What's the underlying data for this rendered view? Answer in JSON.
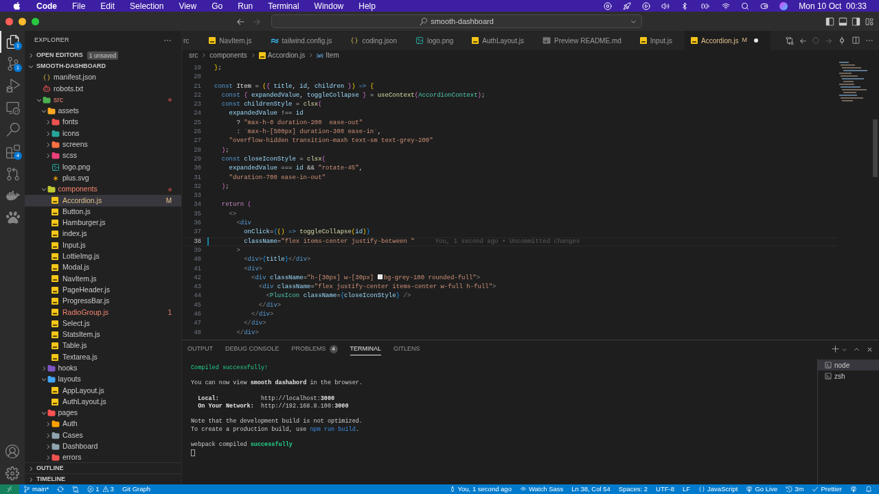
{
  "menubar": {
    "app": "Code",
    "menus": [
      "File",
      "Edit",
      "Selection",
      "View",
      "Go",
      "Run",
      "Terminal",
      "Window",
      "Help"
    ],
    "clock": "Mon 10 Oct  00:33"
  },
  "title_bar": {
    "search": "smooth-dashboard"
  },
  "activity_bar": [
    {
      "kind": "files",
      "selected": true,
      "badge": "1"
    },
    {
      "kind": "source-control",
      "selected": false,
      "badge": "1"
    },
    {
      "kind": "run-debug",
      "selected": false
    },
    {
      "kind": "remote",
      "selected": false
    },
    {
      "kind": "search",
      "selected": false
    },
    {
      "kind": "extensions",
      "selected": false,
      "badge": "4"
    },
    {
      "kind": "git-graph",
      "selected": false
    },
    {
      "kind": "docker",
      "selected": false
    },
    {
      "kind": "paw",
      "selected": false
    }
  ],
  "explorer": {
    "title": "EXPLORER",
    "open_editors": {
      "label": "OPEN EDITORS",
      "badge": "1 unsaved"
    },
    "root": "SMOOTH-DASHBOARD",
    "tree": [
      {
        "name": "manifest.json",
        "kind": "json",
        "selected": false,
        "modified": false,
        "problem": false
      },
      {
        "name": "robots.txt",
        "kind": "robot",
        "selected": false,
        "modified": false,
        "problem": false
      },
      {
        "name": "src",
        "kind": "folder",
        "expanded": true,
        "color": "#4caf50",
        "selected": false,
        "modified": false,
        "problem": true,
        "children": [
          {
            "name": "assets",
            "kind": "folder",
            "expanded": true,
            "color": "#f9a825",
            "selected": false,
            "modified": false,
            "problem": false,
            "children": [
              {
                "name": "fonts",
                "kind": "folder",
                "expanded": false,
                "color": "#ef5350",
                "selected": false,
                "modified": false,
                "problem": false
              },
              {
                "name": "icons",
                "kind": "folder",
                "expanded": false,
                "color": "#26a69a",
                "selected": false,
                "modified": false,
                "problem": false
              },
              {
                "name": "screens",
                "kind": "folder",
                "expanded": false,
                "color": "#ff7043",
                "selected": false,
                "modified": false,
                "problem": false
              },
              {
                "name": "scss",
                "kind": "folder",
                "expanded": false,
                "color": "#ec407a",
                "selected": false,
                "modified": false,
                "problem": false
              },
              {
                "name": "logo.png",
                "kind": "image",
                "selected": false,
                "modified": false,
                "problem": false
              },
              {
                "name": "plus.svg",
                "kind": "vector",
                "selected": false,
                "modified": false,
                "problem": false
              }
            ]
          },
          {
            "name": "components",
            "kind": "folder",
            "expanded": true,
            "color": "#c0ca33",
            "selected": false,
            "modified": false,
            "problem": true,
            "children": [
              {
                "name": "Accordion.js",
                "kind": "script",
                "badge": "M",
                "selected": true,
                "modified": true,
                "problem": false
              },
              {
                "name": "Button.js",
                "kind": "script",
                "selected": false,
                "modified": false,
                "problem": false
              },
              {
                "name": "Hamburger.js",
                "kind": "script",
                "selected": false,
                "modified": false,
                "problem": false
              },
              {
                "name": "index.js",
                "kind": "script",
                "selected": false,
                "modified": false,
                "problem": false
              },
              {
                "name": "Input.js",
                "kind": "script",
                "selected": false,
                "modified": false,
                "problem": false
              },
              {
                "name": "LottieImg.js",
                "kind": "script",
                "selected": false,
                "modified": false,
                "problem": false
              },
              {
                "name": "Modal.js",
                "kind": "script",
                "selected": false,
                "modified": false,
                "problem": false
              },
              {
                "name": "NavItem.js",
                "kind": "script",
                "selected": false,
                "modified": false,
                "problem": false
              },
              {
                "name": "PageHeader.js",
                "kind": "script",
                "selected": false,
                "modified": false,
                "problem": false
              },
              {
                "name": "ProgressBar.js",
                "kind": "script",
                "selected": false,
                "modified": false,
                "problem": false
              },
              {
                "name": "RadioGroup.js",
                "kind": "script",
                "badge": "1",
                "selected": false,
                "modified": false,
                "problem": true
              },
              {
                "name": "Select.js",
                "kind": "script",
                "selected": false,
                "modified": false,
                "problem": false
              },
              {
                "name": "StatsItem.js",
                "kind": "script",
                "selected": false,
                "modified": false,
                "problem": false
              },
              {
                "name": "Table.js",
                "kind": "script",
                "selected": false,
                "modified": false,
                "problem": false
              },
              {
                "name": "Textarea.js",
                "kind": "script",
                "selected": false,
                "modified": false,
                "problem": false
              }
            ]
          },
          {
            "name": "hooks",
            "kind": "folder",
            "expanded": false,
            "color": "#7e57c2",
            "selected": false,
            "modified": false,
            "problem": false
          },
          {
            "name": "layouts",
            "kind": "folder",
            "expanded": true,
            "color": "#42a5f5",
            "selected": false,
            "modified": false,
            "problem": false,
            "children": [
              {
                "name": "AppLayout.js",
                "kind": "script",
                "selected": false,
                "modified": false,
                "problem": false
              },
              {
                "name": "AuthLayout.js",
                "kind": "script",
                "selected": false,
                "modified": false,
                "problem": false
              }
            ]
          },
          {
            "name": "pages",
            "kind": "folder",
            "expanded": true,
            "color": "#ff5252",
            "selected": false,
            "modified": false,
            "problem": false,
            "children": [
              {
                "name": "Auth",
                "kind": "folder",
                "expanded": false,
                "color": "#ffa000",
                "selected": false,
                "modified": false,
                "problem": false
              },
              {
                "name": "Cases",
                "kind": "folder",
                "expanded": false,
                "color": "#90a4ae",
                "selected": false,
                "modified": false,
                "problem": false
              },
              {
                "name": "Dashboard",
                "kind": "folder",
                "expanded": false,
                "color": "#90a4ae",
                "selected": false,
                "modified": false,
                "problem": false
              },
              {
                "name": "errors",
                "kind": "folder",
                "expanded": false,
                "color": "#ef5350",
                "selected": false,
                "modified": false,
                "problem": false
              }
            ]
          }
        ]
      }
    ],
    "sections": [
      "OUTLINE",
      "TIMELINE"
    ]
  },
  "tabs": [
    {
      "label": "rc",
      "kind": "partial",
      "selected": false
    },
    {
      "label": "NavItem.js",
      "kind": "script",
      "selected": false
    },
    {
      "label": "tailwind.config.js",
      "kind": "tailwind",
      "selected": false
    },
    {
      "label": "coding.json",
      "kind": "json",
      "selected": false
    },
    {
      "label": "logo.png",
      "kind": "image",
      "selected": false
    },
    {
      "label": "AuthLayout.js",
      "kind": "script",
      "selected": false
    },
    {
      "label": "Preview README.md",
      "kind": "preview",
      "selected": false
    },
    {
      "label": "Input.js",
      "kind": "script",
      "selected": false
    },
    {
      "label": "Accordion.js",
      "kind": "script",
      "selected": true,
      "badge": "M",
      "dirty": true
    }
  ],
  "breadcrumb": [
    {
      "label": "src",
      "kind": "folder"
    },
    {
      "label": "components",
      "kind": "folder"
    },
    {
      "label": "Accordion.js",
      "kind": "script"
    },
    {
      "label": "Item",
      "kind": "symbol"
    }
  ],
  "code": [
    {
      "n": "19",
      "current": false,
      "tokens": [
        {
          "text": "}",
          "kind": "bracket-gold"
        },
        {
          "text": ";",
          "kind": "punct"
        }
      ]
    },
    {
      "n": "20",
      "current": false
    },
    {
      "n": "21",
      "current": false,
      "tokens": [
        {
          "text": "const ",
          "kind": "keyword"
        },
        {
          "text": "Item",
          "kind": "name"
        },
        {
          "text": " = ",
          "kind": "punct"
        },
        {
          "text": "(",
          "kind": "bracket-gold"
        },
        {
          "text": "{",
          "kind": "bracket-pink"
        },
        {
          "text": " title",
          "kind": "variable"
        },
        {
          "text": ", ",
          "kind": "punct"
        },
        {
          "text": "id",
          "kind": "variable"
        },
        {
          "text": ", ",
          "kind": "punct"
        },
        {
          "text": "children",
          "kind": "variable"
        },
        {
          "text": " }",
          "kind": "bracket-pink"
        },
        {
          "text": ")",
          "kind": "bracket-gold"
        },
        {
          "text": " => ",
          "kind": "keyword"
        },
        {
          "text": "{",
          "kind": "bracket-gold"
        }
      ]
    },
    {
      "n": "22",
      "current": false,
      "tokens": [
        {
          "text": "  const ",
          "kind": "keyword"
        },
        {
          "text": "{",
          "kind": "bracket-pink"
        },
        {
          "text": " expandedValue",
          "kind": "variable"
        },
        {
          "text": ", ",
          "kind": "punct"
        },
        {
          "text": "toggleCollapse",
          "kind": "variable"
        },
        {
          "text": " }",
          "kind": "bracket-pink"
        },
        {
          "text": " = ",
          "kind": "punct"
        },
        {
          "text": "useContext",
          "kind": "function"
        },
        {
          "text": "(",
          "kind": "bracket-pink"
        },
        {
          "text": "AccordionContext",
          "kind": "type"
        },
        {
          "text": ")",
          "kind": "bracket-pink"
        },
        {
          "text": ";",
          "kind": "punct"
        }
      ]
    },
    {
      "n": "23",
      "current": false,
      "tokens": [
        {
          "text": "  const ",
          "kind": "keyword"
        },
        {
          "text": "childrenStyle",
          "kind": "variable"
        },
        {
          "text": " = ",
          "kind": "punct"
        },
        {
          "text": "clsx",
          "kind": "function"
        },
        {
          "text": "(",
          "kind": "bracket-pink"
        }
      ]
    },
    {
      "n": "24",
      "current": false,
      "tokens": [
        {
          "text": "    expandedValue",
          "kind": "variable"
        },
        {
          "text": " !== ",
          "kind": "punct"
        },
        {
          "text": "id",
          "kind": "variable"
        }
      ]
    },
    {
      "n": "25",
      "current": false,
      "tokens": [
        {
          "text": "      ? ",
          "kind": "punct"
        },
        {
          "text": "\"max-h-0 duration-200  ease-out\"",
          "kind": "string"
        }
      ]
    },
    {
      "n": "26",
      "current": false,
      "tokens": [
        {
          "text": "      : ",
          "kind": "punct"
        },
        {
          "text": "`max-h-[500px] duration-300 ease-in`",
          "kind": "string"
        },
        {
          "text": ",",
          "kind": "punct"
        }
      ]
    },
    {
      "n": "27",
      "current": false,
      "tokens": [
        {
          "text": "    \"overflow-hidden transition-maxh text-sm text-grey-200\"",
          "kind": "string"
        }
      ]
    },
    {
      "n": "28",
      "current": false,
      "tokens": [
        {
          "text": "  )",
          "kind": "bracket-pink"
        },
        {
          "text": ";",
          "kind": "punct"
        }
      ]
    },
    {
      "n": "29",
      "current": false,
      "tokens": [
        {
          "text": "  const ",
          "kind": "keyword"
        },
        {
          "text": "closeIconStyle",
          "kind": "variable"
        },
        {
          "text": " = ",
          "kind": "punct"
        },
        {
          "text": "clsx",
          "kind": "function"
        },
        {
          "text": "(",
          "kind": "bracket-pink"
        }
      ]
    },
    {
      "n": "30",
      "current": false,
      "tokens": [
        {
          "text": "    expandedValue",
          "kind": "variable"
        },
        {
          "text": " === ",
          "kind": "punct"
        },
        {
          "text": "id",
          "kind": "variable"
        },
        {
          "text": " && ",
          "kind": "punct"
        },
        {
          "text": "\"rotate-45\"",
          "kind": "string"
        },
        {
          "text": ",",
          "kind": "punct"
        }
      ]
    },
    {
      "n": "31",
      "current": false,
      "tokens": [
        {
          "text": "    \"duration-700 ease-in-out\"",
          "kind": "string"
        }
      ]
    },
    {
      "n": "32",
      "current": false,
      "tokens": [
        {
          "text": "  )",
          "kind": "bracket-pink"
        },
        {
          "text": ";",
          "kind": "punct"
        }
      ]
    },
    {
      "n": "33",
      "current": false
    },
    {
      "n": "34",
      "current": false,
      "tokens": [
        {
          "text": "  return ",
          "kind": "control"
        },
        {
          "text": "(",
          "kind": "bracket-pink"
        }
      ]
    },
    {
      "n": "35",
      "current": false,
      "tokens": [
        {
          "text": "    <>",
          "kind": "angle"
        }
      ]
    },
    {
      "n": "36",
      "current": false,
      "tokens": [
        {
          "text": "      <",
          "kind": "angle"
        },
        {
          "text": "div",
          "kind": "tag"
        }
      ]
    },
    {
      "n": "37",
      "current": false,
      "tokens": [
        {
          "text": "        onClick",
          "kind": "variable"
        },
        {
          "text": "=",
          "kind": "punct"
        },
        {
          "text": "{",
          "kind": "bracket-blue"
        },
        {
          "text": "() ",
          "kind": "bracket-gold"
        },
        {
          "text": "=> ",
          "kind": "keyword"
        },
        {
          "text": "toggleCollapse",
          "kind": "function"
        },
        {
          "text": "(",
          "kind": "bracket-gold"
        },
        {
          "text": "id",
          "kind": "variable"
        },
        {
          "text": ")",
          "kind": "bracket-gold"
        },
        {
          "text": "}",
          "kind": "bracket-blue"
        }
      ]
    },
    {
      "n": "38",
      "current": true,
      "blame": "You, 1 second ago • Uncommitted changes",
      "tokens": [
        {
          "text": "        className",
          "kind": "variable"
        },
        {
          "text": "=",
          "kind": "punct"
        },
        {
          "text": "\"flex items-center justify-between \"",
          "kind": "string"
        }
      ]
    },
    {
      "n": "39",
      "current": false,
      "tokens": [
        {
          "text": "      >",
          "kind": "angle"
        }
      ]
    },
    {
      "n": "40",
      "current": false,
      "tokens": [
        {
          "text": "        <",
          "kind": "angle"
        },
        {
          "text": "div",
          "kind": "tag"
        },
        {
          "text": ">",
          "kind": "angle"
        },
        {
          "text": "{",
          "kind": "bracket-blue"
        },
        {
          "text": "title",
          "kind": "variable"
        },
        {
          "text": "}",
          "kind": "bracket-blue"
        },
        {
          "text": "</",
          "kind": "angle"
        },
        {
          "text": "div",
          "kind": "tag"
        },
        {
          "text": ">",
          "kind": "angle"
        }
      ]
    },
    {
      "n": "41",
      "current": false,
      "tokens": [
        {
          "text": "        <",
          "kind": "angle"
        },
        {
          "text": "div",
          "kind": "tag"
        },
        {
          "text": ">",
          "kind": "angle"
        }
      ]
    },
    {
      "n": "42",
      "current": false,
      "tokens": [
        {
          "text": "          <",
          "kind": "angle"
        },
        {
          "text": "div ",
          "kind": "tag"
        },
        {
          "text": "className",
          "kind": "variable"
        },
        {
          "text": "=",
          "kind": "punct"
        },
        {
          "text": "\"h-[30px] w-[30px] ",
          "kind": "string"
        },
        {
          "kind": "swatch",
          "color": "#e5e7eb"
        },
        {
          "text": "bg-grey-100 rounded-full\"",
          "kind": "string"
        },
        {
          "text": ">",
          "kind": "angle"
        }
      ]
    },
    {
      "n": "43",
      "current": false,
      "tokens": [
        {
          "text": "            <",
          "kind": "angle"
        },
        {
          "text": "div ",
          "kind": "tag"
        },
        {
          "text": "className",
          "kind": "variable"
        },
        {
          "text": "=",
          "kind": "punct"
        },
        {
          "text": "\"flex justify-center items-center w-full h-full\"",
          "kind": "string"
        },
        {
          "text": ">",
          "kind": "angle"
        }
      ]
    },
    {
      "n": "44",
      "current": false,
      "tokens": [
        {
          "text": "              <",
          "kind": "angle"
        },
        {
          "text": "PlusIcon ",
          "kind": "type"
        },
        {
          "text": "className",
          "kind": "variable"
        },
        {
          "text": "=",
          "kind": "punct"
        },
        {
          "text": "{",
          "kind": "bracket-blue"
        },
        {
          "text": "closeIconStyle",
          "kind": "variable"
        },
        {
          "text": "}",
          "kind": "bracket-blue"
        },
        {
          "text": " />",
          "kind": "angle"
        }
      ]
    },
    {
      "n": "45",
      "current": false,
      "tokens": [
        {
          "text": "            </",
          "kind": "angle"
        },
        {
          "text": "div",
          "kind": "tag"
        },
        {
          "text": ">",
          "kind": "angle"
        }
      ]
    },
    {
      "n": "46",
      "current": false,
      "tokens": [
        {
          "text": "          </",
          "kind": "angle"
        },
        {
          "text": "div",
          "kind": "tag"
        },
        {
          "text": ">",
          "kind": "angle"
        }
      ]
    },
    {
      "n": "47",
      "current": false,
      "tokens": [
        {
          "text": "        </",
          "kind": "angle"
        },
        {
          "text": "div",
          "kind": "tag"
        },
        {
          "text": ">",
          "kind": "angle"
        }
      ]
    },
    {
      "n": "48",
      "current": false,
      "tokens": [
        {
          "text": "      </",
          "kind": "angle"
        },
        {
          "text": "div",
          "kind": "tag"
        },
        {
          "text": ">",
          "kind": "angle"
        }
      ]
    }
  ],
  "panel": {
    "tabs": [
      {
        "label": "OUTPUT",
        "selected": false
      },
      {
        "label": "DEBUG CONSOLE",
        "selected": false
      },
      {
        "label": "PROBLEMS",
        "selected": false,
        "badge": "4"
      },
      {
        "label": "TERMINAL",
        "selected": true
      },
      {
        "label": "GITLENS",
        "selected": false
      }
    ],
    "terminal": [
      {
        "kind": "text",
        "segments": [
          {
            "text": "Compiled successfully!",
            "kind": "green"
          }
        ]
      },
      {
        "kind": "blank"
      },
      {
        "kind": "text",
        "segments": [
          {
            "text": "You can now view ",
            "kind": "plain"
          },
          {
            "text": "smooth dashabord",
            "kind": "bold"
          },
          {
            "text": " in the browser.",
            "kind": "plain"
          }
        ]
      },
      {
        "kind": "blank"
      },
      {
        "kind": "text",
        "segments": [
          {
            "text": "  Local:",
            "kind": "bold"
          },
          {
            "text": "            http://localhost:",
            "kind": "plain"
          },
          {
            "text": "3000",
            "kind": "bold"
          }
        ]
      },
      {
        "kind": "text",
        "segments": [
          {
            "text": "  On Your Network:",
            "kind": "bold"
          },
          {
            "text": "  http://192.168.8.100:",
            "kind": "plain"
          },
          {
            "text": "3000",
            "kind": "bold"
          }
        ]
      },
      {
        "kind": "blank"
      },
      {
        "kind": "text",
        "segments": [
          {
            "text": "Note that the development build is not optimized.",
            "kind": "plain"
          }
        ]
      },
      {
        "kind": "text",
        "segments": [
          {
            "text": "To create a production build, use ",
            "kind": "plain"
          },
          {
            "text": "npm run build",
            "kind": "link"
          },
          {
            "text": ".",
            "kind": "plain"
          }
        ]
      },
      {
        "kind": "blank"
      },
      {
        "kind": "text",
        "segments": [
          {
            "text": "webpack compiled ",
            "kind": "plain"
          },
          {
            "text": "successfully",
            "kind": "green-bold"
          }
        ]
      },
      {
        "kind": "cursor"
      }
    ],
    "shells": [
      {
        "label": "node",
        "selected": true
      },
      {
        "label": "zsh",
        "selected": false
      }
    ]
  },
  "status_bar": {
    "branch": "main*",
    "errors": "1",
    "warnings": "3",
    "git_graph": "Git Graph",
    "right": [
      {
        "kind": "person",
        "text": "You, 1 second ago"
      },
      {
        "kind": "eye",
        "text": "Watch Sass"
      },
      {
        "kind": "text",
        "text": "Ln 38, Col 54"
      },
      {
        "kind": "text",
        "text": "Spaces: 2"
      },
      {
        "kind": "text",
        "text": "UTF-8"
      },
      {
        "kind": "text",
        "text": "LF"
      },
      {
        "kind": "braces",
        "text": "JavaScript"
      },
      {
        "kind": "broadcast",
        "text": "Go Live"
      },
      {
        "kind": "history",
        "text": "3m"
      },
      {
        "kind": "check",
        "text": "Prettier"
      }
    ]
  }
}
